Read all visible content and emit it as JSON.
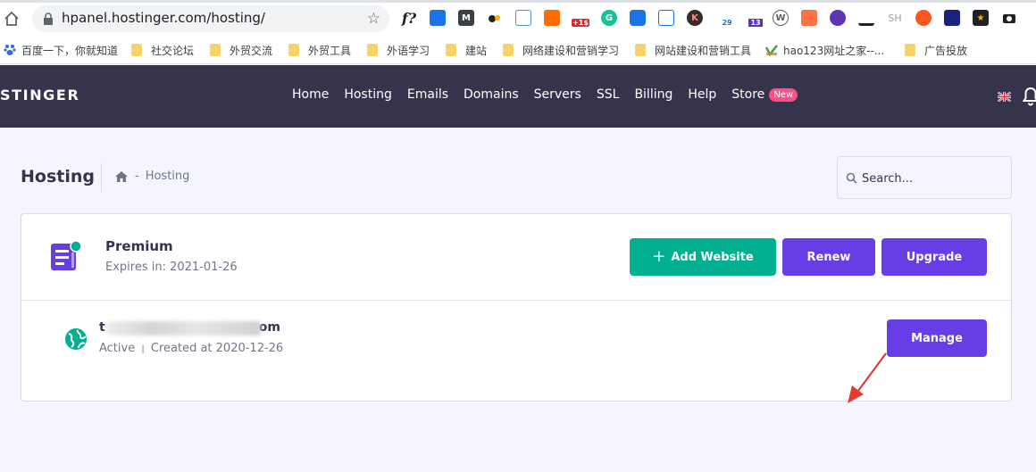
{
  "browser": {
    "url": "hpanel.hostinger.com/hosting/",
    "bookmarks": [
      {
        "label": "百度一下，你就知道",
        "type": "paw"
      },
      {
        "label": "社交论坛",
        "type": "folder"
      },
      {
        "label": "外贸交流",
        "type": "folder"
      },
      {
        "label": "外贸工具",
        "type": "folder"
      },
      {
        "label": "外语学习",
        "type": "folder"
      },
      {
        "label": "建站",
        "type": "folder"
      },
      {
        "label": "网络建设和营销学习",
        "type": "folder"
      },
      {
        "label": "网站建设和营销工具",
        "type": "folder"
      },
      {
        "label": "hao123网址之家--...",
        "type": "hao"
      },
      {
        "label": "广告投放",
        "type": "folder"
      }
    ],
    "extension_labels": {
      "f_label": "f?",
      "badge_15": "+1$",
      "badge_29": "29",
      "badge_13": "13",
      "sh_label": "SH",
      "k_label": "K"
    }
  },
  "header": {
    "logo": "STINGER",
    "nav": [
      {
        "label": "Home"
      },
      {
        "label": "Hosting"
      },
      {
        "label": "Emails"
      },
      {
        "label": "Domains"
      },
      {
        "label": "Servers"
      },
      {
        "label": "SSL"
      },
      {
        "label": "Billing"
      },
      {
        "label": "Help"
      },
      {
        "label": "Store"
      }
    ],
    "new_badge": "New"
  },
  "page": {
    "title": "Hosting",
    "breadcrumb_sep": "-",
    "breadcrumb_current": "Hosting",
    "search_placeholder": "Search..."
  },
  "plan": {
    "name": "Premium",
    "expiry": "Expires in: 2021-01-26",
    "add_website_label": "Add Website",
    "add_plus": "+",
    "renew_label": "Renew",
    "upgrade_label": "Upgrade"
  },
  "website": {
    "domain_start": "t",
    "domain_end": "om",
    "status": "Active",
    "pipe": "|",
    "created": "Created at 2020-12-26",
    "manage_label": "Manage"
  },
  "colors": {
    "header_bg": "#36344d",
    "primary": "#673de6",
    "success": "#00b090",
    "badge": "#fc5185",
    "annotation_arrow": "#e53935"
  }
}
